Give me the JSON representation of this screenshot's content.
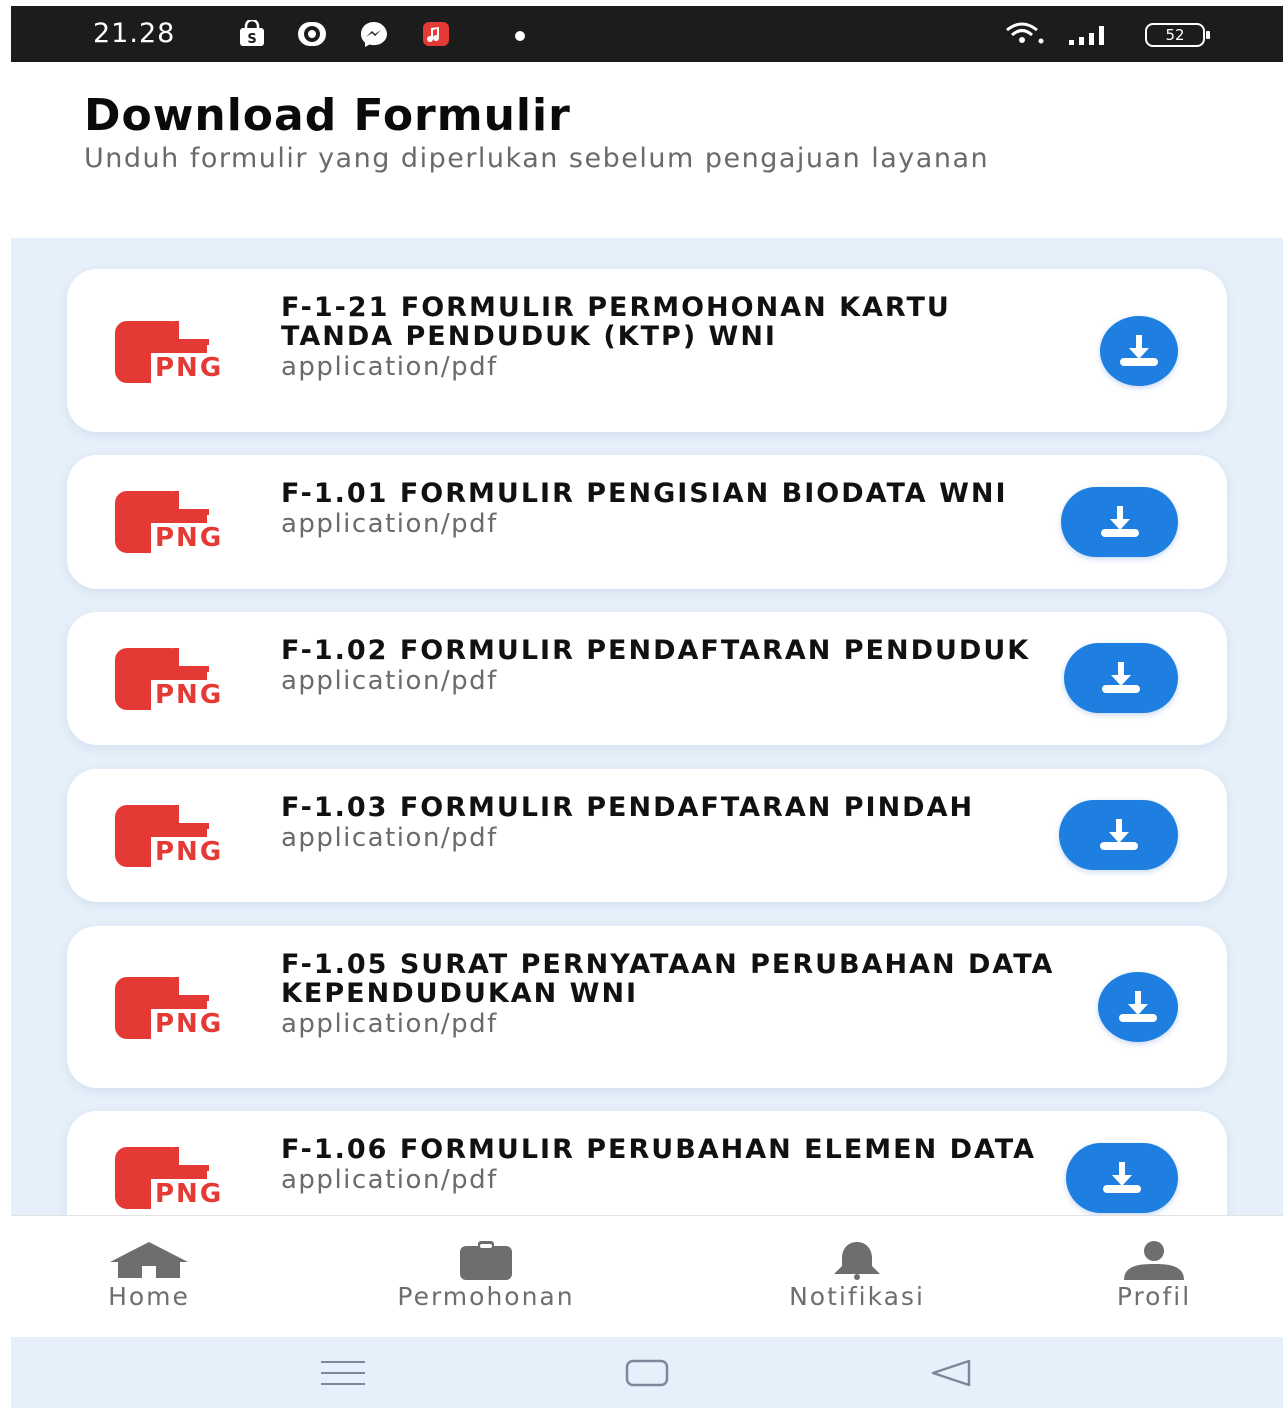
{
  "status_bar": {
    "time": "21.28",
    "notification_icons": [
      "shopping-bag-icon",
      "video-call-icon",
      "messenger-icon",
      "music-icon"
    ],
    "system_icons": [
      "wifi-icon",
      "signal-icon"
    ],
    "battery": "52"
  },
  "header": {
    "title": "Download Formulir",
    "subtitle": "Unduh formulir yang diperlukan sebelum pengajuan layanan"
  },
  "file_icon_label": "PNG",
  "forms": [
    {
      "title": "F-1-21 FORMULIR PERMOHONAN KARTU TANDA PENDUDUK (KTP) WNI",
      "type": "application/pdf"
    },
    {
      "title": "F-1.01 FORMULIR PENGISIAN BIODATA WNI",
      "type": "application/pdf"
    },
    {
      "title": "F-1.02 FORMULIR PENDAFTARAN PENDUDUK",
      "type": "application/pdf"
    },
    {
      "title": "F-1.03 FORMULIR PENDAFTARAN PINDAH",
      "type": "application/pdf"
    },
    {
      "title": "F-1.05 SURAT PERNYATAAN PERUBAHAN DATA KEPENDUDUKAN WNI",
      "type": "application/pdf"
    },
    {
      "title": "F-1.06 FORMULIR PERUBAHAN ELEMEN DATA",
      "type": "application/pdf"
    }
  ],
  "bottom_nav": [
    {
      "label": "Home",
      "icon": "home-icon"
    },
    {
      "label": "Permohonan",
      "icon": "clipboard-icon"
    },
    {
      "label": "Notifikasi",
      "icon": "bell-icon"
    },
    {
      "label": "Profil",
      "icon": "user-icon"
    }
  ],
  "system_nav": [
    "menu-icon",
    "home-square-icon",
    "back-triangle-icon"
  ],
  "colors": {
    "accent_blue": "#1e7fe0",
    "file_red": "#e53935",
    "background_tint": "#e6f0fa",
    "nav_gray": "#6e6e6e"
  }
}
